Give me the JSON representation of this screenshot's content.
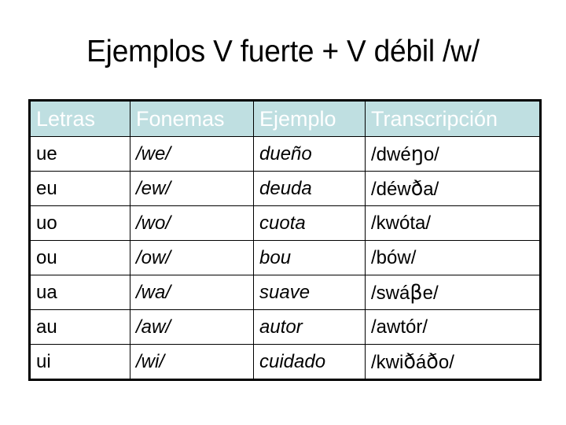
{
  "slide": {
    "title": "Ejemplos V fuerte + V débil /w/",
    "background_color": "#ffffff"
  },
  "table": {
    "header_background": "#bfdfe1",
    "header_text_color": "#ffffff",
    "border_color": "#000000",
    "columns": [
      {
        "key": "letters",
        "label": "Letras"
      },
      {
        "key": "phonemes",
        "label": "Fonemas"
      },
      {
        "key": "example",
        "label": "Ejemplo"
      },
      {
        "key": "transcription",
        "label": "Transcripción"
      }
    ],
    "rows": [
      {
        "letters": "ue",
        "phonemes": "/we/",
        "example": "dueño",
        "transcription": "/dwéŋo/"
      },
      {
        "letters": "eu",
        "phonemes": "/ew/",
        "example": "deuda",
        "transcription": "/déwða/"
      },
      {
        "letters": "uo",
        "phonemes": "/wo/",
        "example": "cuota",
        "transcription": "/kwóta/"
      },
      {
        "letters": "ou",
        "phonemes": "/ow/",
        "example": "bou",
        "transcription": "/bów/"
      },
      {
        "letters": "ua",
        "phonemes": "/wa/",
        "example": "suave",
        "transcription": "/swáβe/"
      },
      {
        "letters": "au",
        "phonemes": "/aw/",
        "example": "autor",
        "transcription": "/awtór/"
      },
      {
        "letters": "ui",
        "phonemes": "/wi/",
        "example": "cuidado",
        "transcription": "/kwiðáðo/"
      }
    ]
  }
}
